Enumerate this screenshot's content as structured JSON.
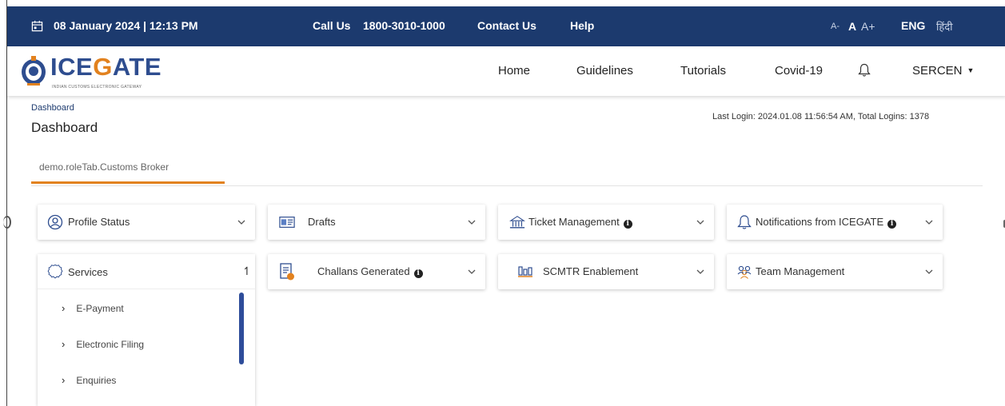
{
  "topbar": {
    "date": "08 January 2024 | 12:13 PM",
    "call_label": "Call Us",
    "phone": "1800-3010-1000",
    "contact": "Contact Us",
    "help": "Help",
    "font_small": "A-",
    "font_normal": "A",
    "font_large": "A+",
    "lang_eng": "ENG",
    "lang_hindi": "हिंदी"
  },
  "logo": {
    "word_start": "ICE",
    "word_mid": "G",
    "word_end": "ATE",
    "tagline": "INDIAN CUSTOMS ELECTRONIC GATEWAY"
  },
  "nav": {
    "home": "Home",
    "guidelines": "Guidelines",
    "tutorials": "Tutorials",
    "covid": "Covid-19",
    "user": "SERCEN"
  },
  "dashboard": {
    "breadcrumb": "Dashboard",
    "title": "Dashboard",
    "last_login": "Last Login: 2024.01.08 11:56:54 AM, Total Logins: 1378",
    "role_tab": "demo.roleTab.Customs Broker"
  },
  "cards": {
    "profile_status": "Profile Status",
    "drafts": "Drafts",
    "ticket_management": "Ticket Management",
    "notifications": "Notifications from ICEGATE",
    "challans": "Challans Generated",
    "scmtr": "SCMTR Enablement",
    "team": "Team Management"
  },
  "services": {
    "title": "Services",
    "items": [
      {
        "label": "E-Payment"
      },
      {
        "label": "Electronic Filing"
      },
      {
        "label": "Enquiries"
      }
    ]
  },
  "colors": {
    "header_bg": "#1c3a6e",
    "accent_orange": "#e2821f",
    "scroll_blue": "#2e4d9a"
  }
}
